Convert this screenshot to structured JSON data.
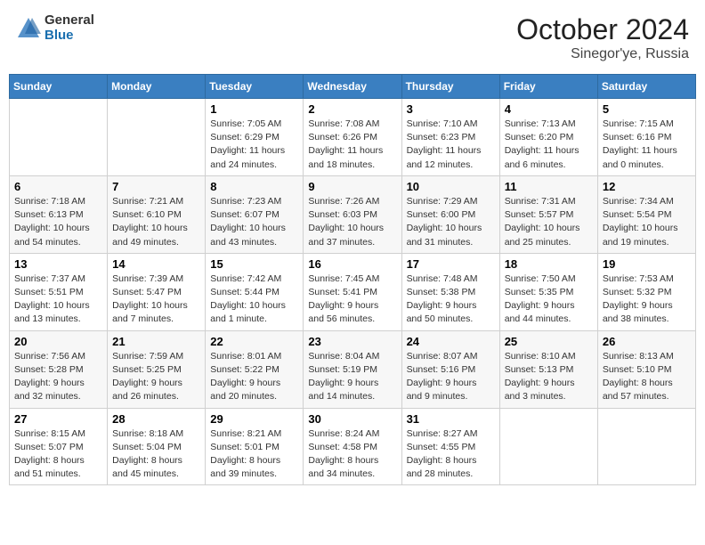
{
  "header": {
    "logo_general": "General",
    "logo_blue": "Blue",
    "month_title": "October 2024",
    "location": "Sinegor'ye, Russia"
  },
  "weekdays": [
    "Sunday",
    "Monday",
    "Tuesday",
    "Wednesday",
    "Thursday",
    "Friday",
    "Saturday"
  ],
  "weeks": [
    [
      {
        "day": "",
        "info": ""
      },
      {
        "day": "",
        "info": ""
      },
      {
        "day": "1",
        "info": "Sunrise: 7:05 AM\nSunset: 6:29 PM\nDaylight: 11 hours and 24 minutes."
      },
      {
        "day": "2",
        "info": "Sunrise: 7:08 AM\nSunset: 6:26 PM\nDaylight: 11 hours and 18 minutes."
      },
      {
        "day": "3",
        "info": "Sunrise: 7:10 AM\nSunset: 6:23 PM\nDaylight: 11 hours and 12 minutes."
      },
      {
        "day": "4",
        "info": "Sunrise: 7:13 AM\nSunset: 6:20 PM\nDaylight: 11 hours and 6 minutes."
      },
      {
        "day": "5",
        "info": "Sunrise: 7:15 AM\nSunset: 6:16 PM\nDaylight: 11 hours and 0 minutes."
      }
    ],
    [
      {
        "day": "6",
        "info": "Sunrise: 7:18 AM\nSunset: 6:13 PM\nDaylight: 10 hours and 54 minutes."
      },
      {
        "day": "7",
        "info": "Sunrise: 7:21 AM\nSunset: 6:10 PM\nDaylight: 10 hours and 49 minutes."
      },
      {
        "day": "8",
        "info": "Sunrise: 7:23 AM\nSunset: 6:07 PM\nDaylight: 10 hours and 43 minutes."
      },
      {
        "day": "9",
        "info": "Sunrise: 7:26 AM\nSunset: 6:03 PM\nDaylight: 10 hours and 37 minutes."
      },
      {
        "day": "10",
        "info": "Sunrise: 7:29 AM\nSunset: 6:00 PM\nDaylight: 10 hours and 31 minutes."
      },
      {
        "day": "11",
        "info": "Sunrise: 7:31 AM\nSunset: 5:57 PM\nDaylight: 10 hours and 25 minutes."
      },
      {
        "day": "12",
        "info": "Sunrise: 7:34 AM\nSunset: 5:54 PM\nDaylight: 10 hours and 19 minutes."
      }
    ],
    [
      {
        "day": "13",
        "info": "Sunrise: 7:37 AM\nSunset: 5:51 PM\nDaylight: 10 hours and 13 minutes."
      },
      {
        "day": "14",
        "info": "Sunrise: 7:39 AM\nSunset: 5:47 PM\nDaylight: 10 hours and 7 minutes."
      },
      {
        "day": "15",
        "info": "Sunrise: 7:42 AM\nSunset: 5:44 PM\nDaylight: 10 hours and 1 minute."
      },
      {
        "day": "16",
        "info": "Sunrise: 7:45 AM\nSunset: 5:41 PM\nDaylight: 9 hours and 56 minutes."
      },
      {
        "day": "17",
        "info": "Sunrise: 7:48 AM\nSunset: 5:38 PM\nDaylight: 9 hours and 50 minutes."
      },
      {
        "day": "18",
        "info": "Sunrise: 7:50 AM\nSunset: 5:35 PM\nDaylight: 9 hours and 44 minutes."
      },
      {
        "day": "19",
        "info": "Sunrise: 7:53 AM\nSunset: 5:32 PM\nDaylight: 9 hours and 38 minutes."
      }
    ],
    [
      {
        "day": "20",
        "info": "Sunrise: 7:56 AM\nSunset: 5:28 PM\nDaylight: 9 hours and 32 minutes."
      },
      {
        "day": "21",
        "info": "Sunrise: 7:59 AM\nSunset: 5:25 PM\nDaylight: 9 hours and 26 minutes."
      },
      {
        "day": "22",
        "info": "Sunrise: 8:01 AM\nSunset: 5:22 PM\nDaylight: 9 hours and 20 minutes."
      },
      {
        "day": "23",
        "info": "Sunrise: 8:04 AM\nSunset: 5:19 PM\nDaylight: 9 hours and 14 minutes."
      },
      {
        "day": "24",
        "info": "Sunrise: 8:07 AM\nSunset: 5:16 PM\nDaylight: 9 hours and 9 minutes."
      },
      {
        "day": "25",
        "info": "Sunrise: 8:10 AM\nSunset: 5:13 PM\nDaylight: 9 hours and 3 minutes."
      },
      {
        "day": "26",
        "info": "Sunrise: 8:13 AM\nSunset: 5:10 PM\nDaylight: 8 hours and 57 minutes."
      }
    ],
    [
      {
        "day": "27",
        "info": "Sunrise: 8:15 AM\nSunset: 5:07 PM\nDaylight: 8 hours and 51 minutes."
      },
      {
        "day": "28",
        "info": "Sunrise: 8:18 AM\nSunset: 5:04 PM\nDaylight: 8 hours and 45 minutes."
      },
      {
        "day": "29",
        "info": "Sunrise: 8:21 AM\nSunset: 5:01 PM\nDaylight: 8 hours and 39 minutes."
      },
      {
        "day": "30",
        "info": "Sunrise: 8:24 AM\nSunset: 4:58 PM\nDaylight: 8 hours and 34 minutes."
      },
      {
        "day": "31",
        "info": "Sunrise: 8:27 AM\nSunset: 4:55 PM\nDaylight: 8 hours and 28 minutes."
      },
      {
        "day": "",
        "info": ""
      },
      {
        "day": "",
        "info": ""
      }
    ]
  ]
}
